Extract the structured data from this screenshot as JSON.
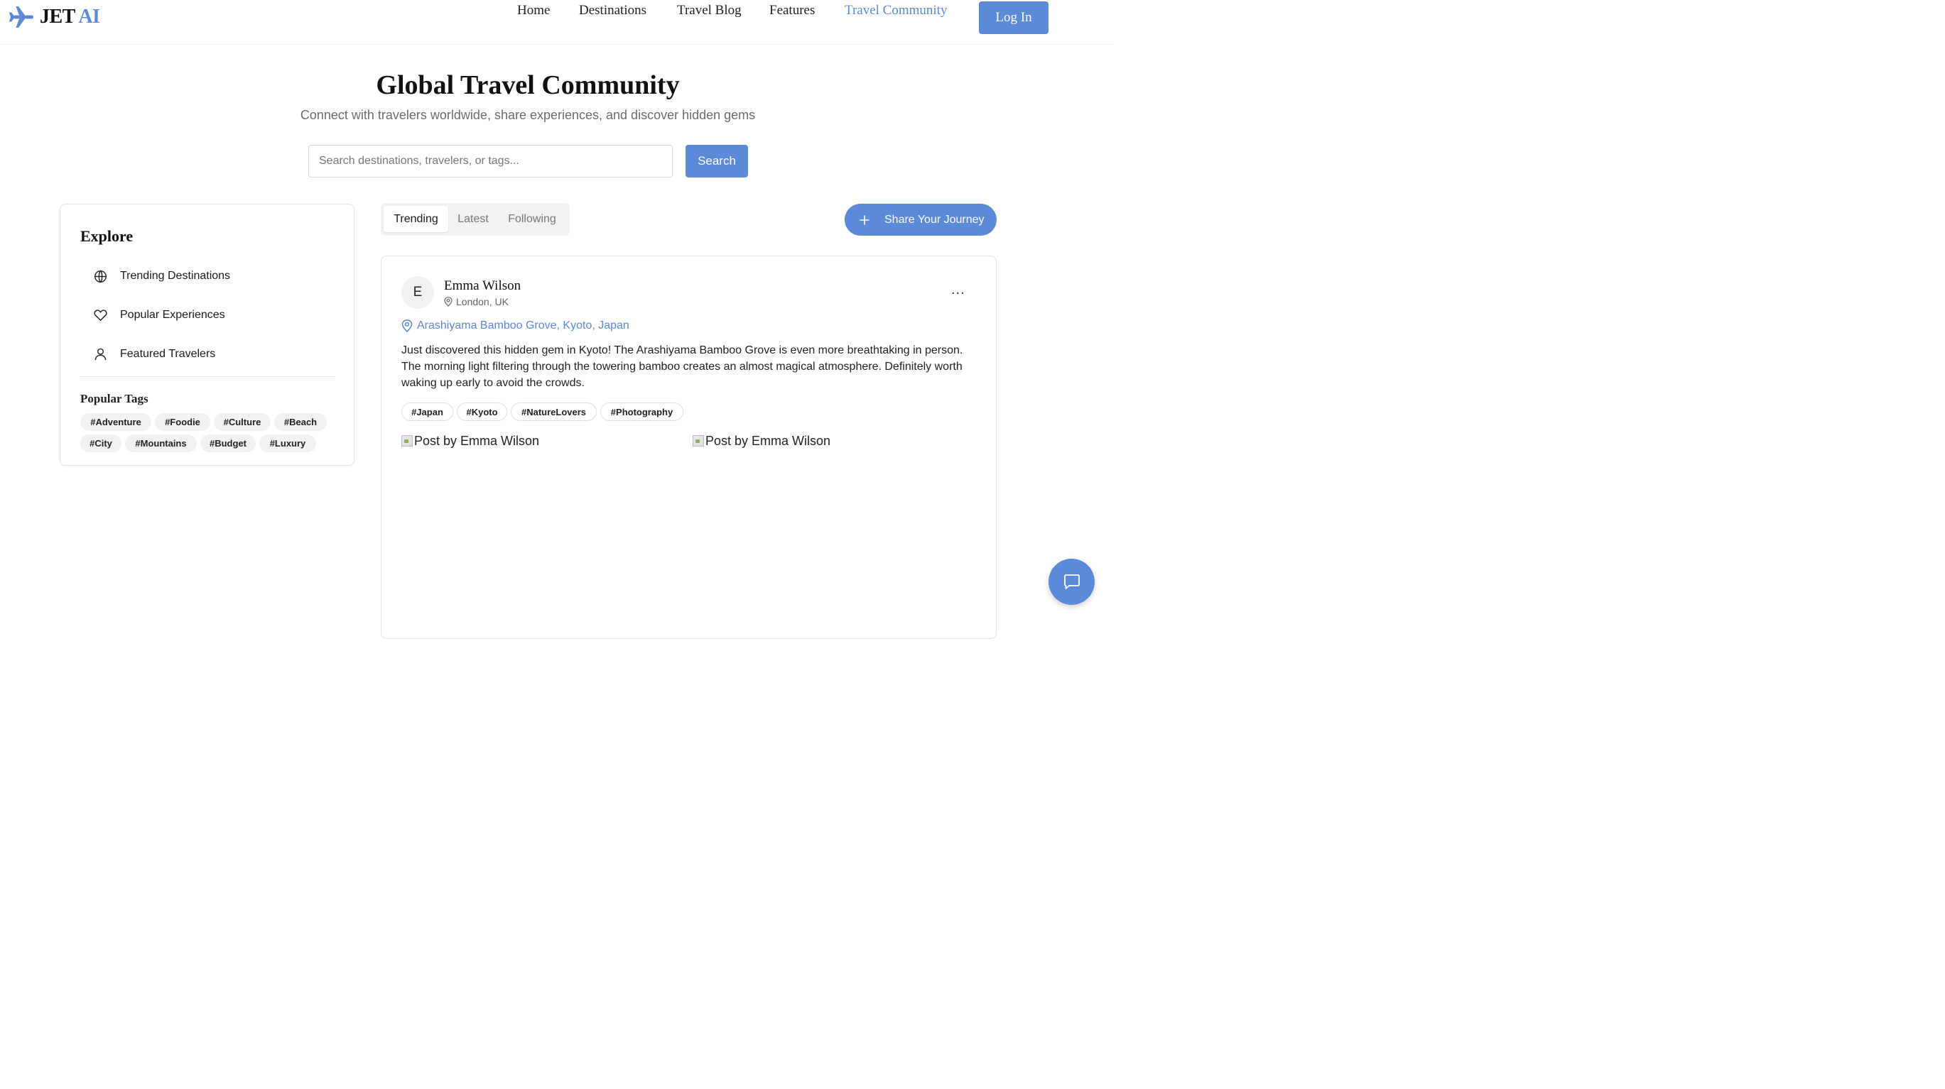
{
  "brand": {
    "jet": "JET",
    "ai": "AI",
    "accent": "#5b8ad8"
  },
  "nav": {
    "items": [
      {
        "label": "Home"
      },
      {
        "label": "Destinations"
      },
      {
        "label": "Travel Blog"
      },
      {
        "label": "Features"
      },
      {
        "label": "Travel Community",
        "active": true
      }
    ],
    "login": "Log In"
  },
  "hero": {
    "title": "Global Travel Community",
    "subtitle": "Connect with travelers worldwide, share experiences, and discover hidden gems"
  },
  "search": {
    "placeholder": "Search destinations, travelers, or tags...",
    "button": "Search"
  },
  "sidebar": {
    "title": "Explore",
    "items": [
      {
        "label": "Trending Destinations",
        "icon": "globe-icon"
      },
      {
        "label": "Popular Experiences",
        "icon": "heart-icon"
      },
      {
        "label": "Featured Travelers",
        "icon": "user-icon"
      }
    ],
    "tags_title": "Popular Tags",
    "tags": [
      "#Adventure",
      "#Foodie",
      "#Culture",
      "#Beach",
      "#City",
      "#Mountains",
      "#Budget",
      "#Luxury"
    ]
  },
  "feed": {
    "tabs": [
      {
        "label": "Trending",
        "active": true
      },
      {
        "label": "Latest"
      },
      {
        "label": "Following"
      }
    ],
    "share_button": "Share Your Journey"
  },
  "post": {
    "avatar_initial": "E",
    "author": "Emma Wilson",
    "author_location": "London, UK",
    "more": "...",
    "place": "Arashiyama Bamboo Grove, Kyoto, Japan",
    "text": "Just discovered this hidden gem in Kyoto! The Arashiyama Bamboo Grove is even more breathtaking in person. The morning light filtering through the towering bamboo creates an almost magical atmosphere. Definitely worth waking up early to avoid the crowds.",
    "tags": [
      "#Japan",
      "#Kyoto",
      "#NatureLovers",
      "#Photography"
    ],
    "images": [
      {
        "alt": "Post by Emma Wilson"
      },
      {
        "alt": "Post by Emma Wilson"
      }
    ]
  }
}
